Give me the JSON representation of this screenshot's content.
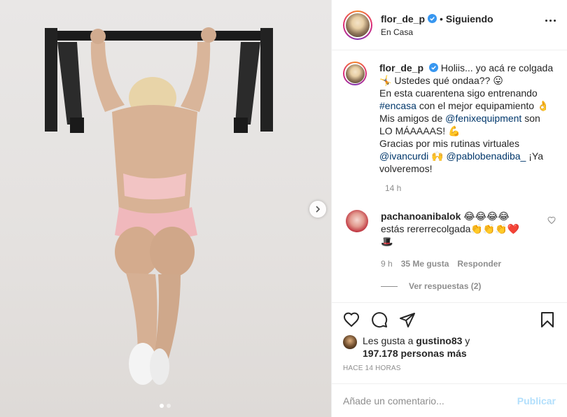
{
  "post": {
    "username": "flor_de_p",
    "follow_label": "Siguiendo",
    "location": "En Casa",
    "carousel_index": 1,
    "carousel_total": 2
  },
  "caption": {
    "username": "flor_de_p",
    "l1": "Holiis... yo acá re colgada",
    "l1_emoji": "😛",
    "l2_emoji": "🤸",
    "l2": "Ustedes qué ondaa??",
    "l2_end": "😛",
    "l3": "En esta cuarentena sigo entrenando",
    "l4_tag": "#encasa",
    "l4": " con el mejor equipamiento ",
    "l4_emoji": "👌",
    "l5": "Mis amigos de ",
    "l5_link": "@fenixequipment",
    "l5_end": " son",
    "l6": "LO MÁAAAAS! ",
    "l6_emoji": "💪",
    "l7": "Gracias por mis rutinas virtuales",
    "l8_link1": "@ivancurdi",
    "l8_emoji": "🙌",
    "l8_link2": "@pablobenadiba_",
    "l8_end": " ¡Ya",
    "l9": "volveremos!",
    "time": "14 h"
  },
  "comment": {
    "username": "pachanoanibalok",
    "emojis_top": "😂😂😂😂",
    "text": "estás rererrecolgada",
    "emojis_text": "👏👏👏❤️",
    "emoji_hat": "🎩",
    "time": "9 h",
    "likes": "35 Me gusta",
    "reply": "Responder",
    "view_replies": "Ver respuestas (2)"
  },
  "likes": {
    "prefix": "Les gusta a ",
    "user": "gustino83",
    "y": " y",
    "count": "197.178 personas más"
  },
  "post_time": "Hace 14 horas",
  "add_comment": {
    "placeholder": "Añade un comentario...",
    "publish": "Publicar"
  },
  "colors": {
    "link": "#00376b",
    "verified": "#3897f0",
    "muted": "#8e8e8e",
    "publish_disabled": "#b2dffc"
  }
}
